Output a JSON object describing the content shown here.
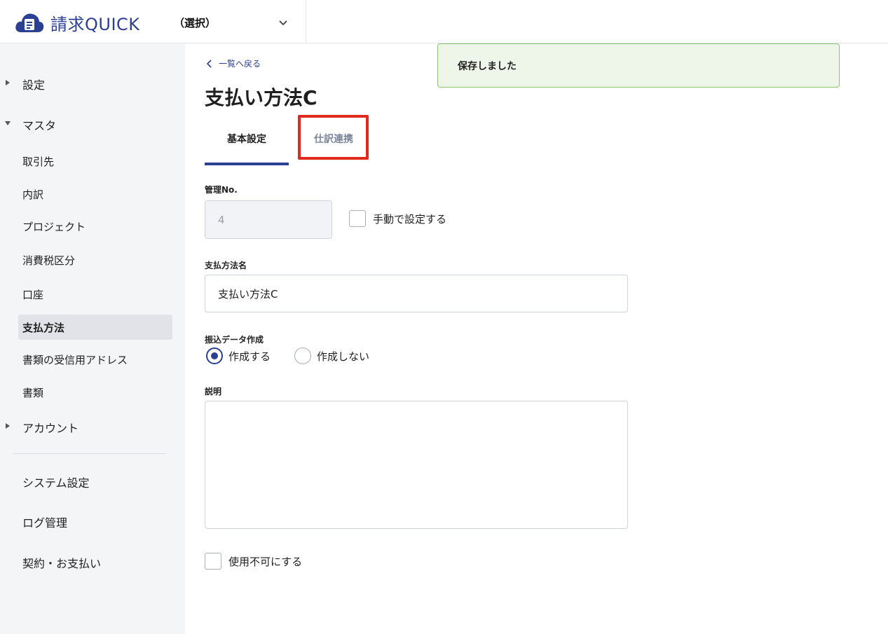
{
  "header": {
    "app_name": "請求QUICK",
    "org_select_value": "（選択）"
  },
  "sidebar": {
    "groups": [
      {
        "label": "設定",
        "expanded": false
      },
      {
        "label": "マスタ",
        "expanded": true
      },
      {
        "label": "アカウント",
        "expanded": false
      }
    ],
    "master_items": [
      {
        "label": "取引先"
      },
      {
        "label": "内訳"
      },
      {
        "label": "プロジェクト"
      },
      {
        "label": "消費税区分"
      },
      {
        "label": "口座"
      },
      {
        "label": "支払方法",
        "active": true
      },
      {
        "label": "書類の受信用アドレス"
      },
      {
        "label": "書類"
      }
    ],
    "bottom_items": [
      {
        "label": "システム設定"
      },
      {
        "label": "ログ管理"
      },
      {
        "label": "契約・お支払い"
      }
    ]
  },
  "main": {
    "back_link": "一覧へ戻る",
    "title": "支払い方法C",
    "tabs": [
      {
        "label": "基本設定",
        "active": true
      },
      {
        "label": "仕訳連携",
        "active": false,
        "highlighted": true
      }
    ],
    "form": {
      "manage_no_label": "管理No.",
      "manage_no_value": "4",
      "manual_set_label": "手動で設定する",
      "method_name_label": "支払方法名",
      "method_name_value": "支払い方法C",
      "transfer_label": "振込データ作成",
      "transfer_options": [
        "作成する",
        "作成しない"
      ],
      "transfer_selected": "作成する",
      "description_label": "説明",
      "description_value": "",
      "disable_label": "使用不可にする"
    }
  },
  "toast": {
    "message": "保存しました"
  },
  "colors": {
    "brand": "#2b3f93",
    "highlight": "#e02b1c",
    "toast_bg": "#eef5e9",
    "toast_border": "#8bc470",
    "sidebar_bg": "#f4f5f7"
  }
}
